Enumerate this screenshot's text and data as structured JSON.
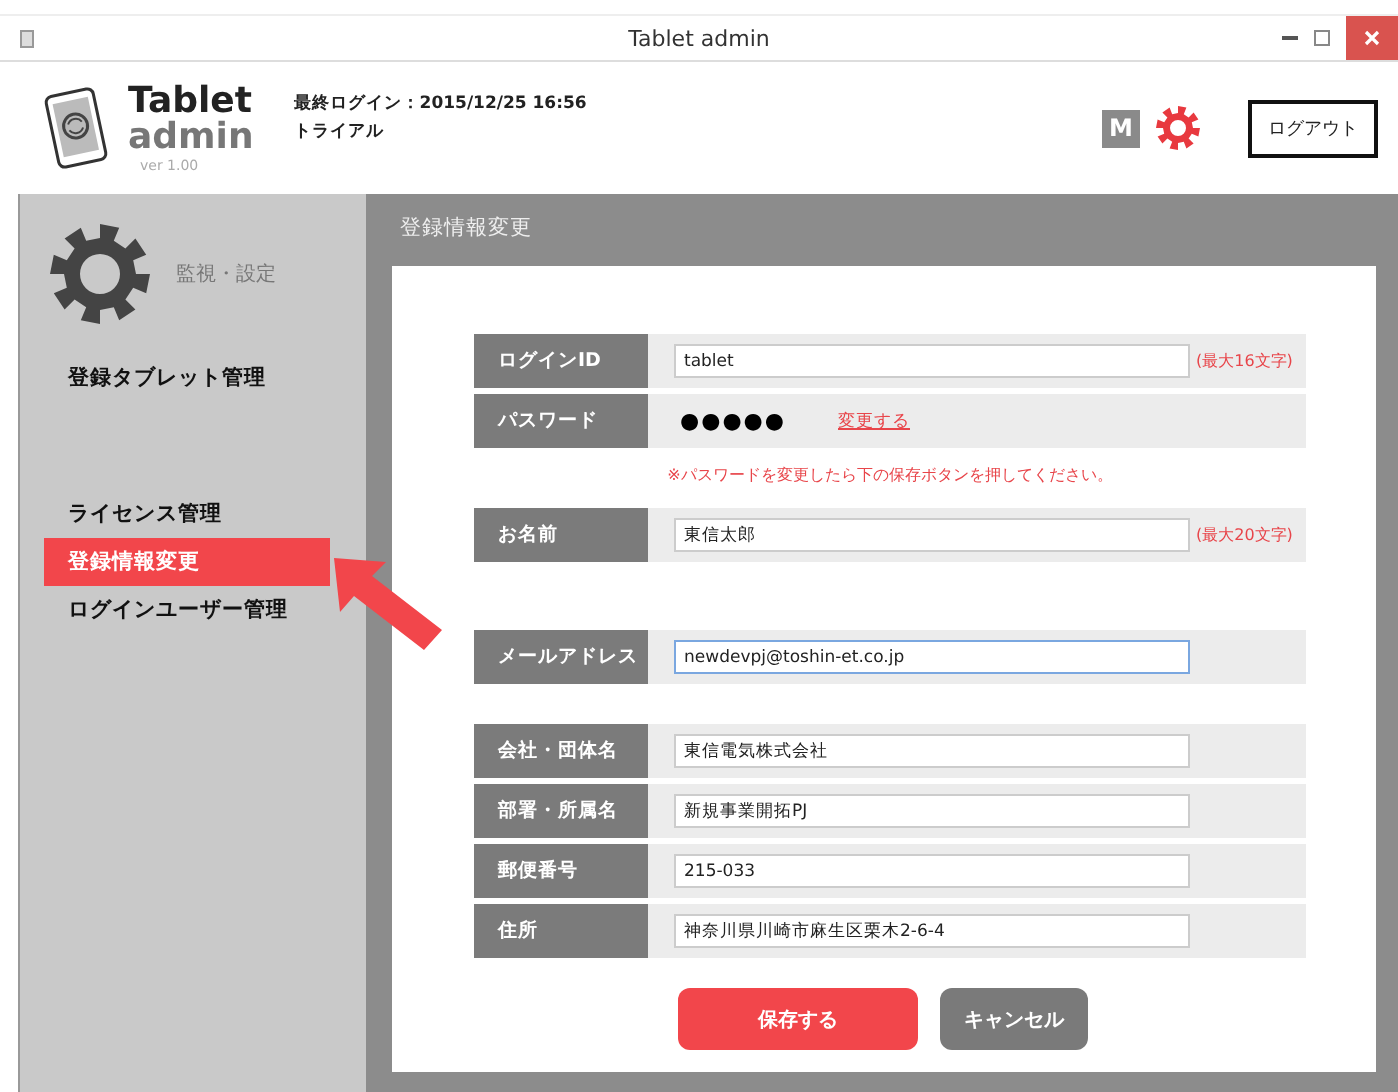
{
  "window": {
    "title": "Tablet admin"
  },
  "header": {
    "logo_title": "Tablet",
    "logo_subtitle": "admin",
    "version": "ver 1.00",
    "last_login": "最終ログイン：2015/12/25 16:56",
    "plan": "トライアル",
    "badge": "M",
    "logout": "ログアウト"
  },
  "sidebar": {
    "section": "監視・設定",
    "groups": [
      [
        {
          "label": "登録タブレット管理",
          "selected": false
        }
      ],
      [
        {
          "label": "ライセンス管理",
          "selected": false
        },
        {
          "label": "登録情報変更",
          "selected": true
        },
        {
          "label": "ログインユーザー管理",
          "selected": false
        }
      ]
    ]
  },
  "main": {
    "heading": "登録情報変更",
    "rows": [
      {
        "kind": "input",
        "label": "ログインID",
        "value": "tablet",
        "hint": "(最大16文字)",
        "focused": false
      },
      {
        "kind": "password",
        "label": "パスワード",
        "mask": "●●●●●",
        "link": "変更する"
      },
      {
        "kind": "note",
        "text": "※パスワードを変更したら下の保存ボタンを押してください。"
      },
      {
        "kind": "input",
        "label": "お名前",
        "value": "東信太郎",
        "hint": "(最大20文字)",
        "focused": false
      },
      {
        "kind": "spacer"
      },
      {
        "kind": "input",
        "label": "メールアドレス",
        "value": "newdevpj@toshin-et.co.jp",
        "focused": true
      },
      {
        "kind": "spacer"
      },
      {
        "kind": "input",
        "label": "会社・団体名",
        "value": "東信電気株式会社",
        "focused": false
      },
      {
        "kind": "input",
        "label": "部署・所属名",
        "value": "新規事業開拓PJ",
        "focused": false
      },
      {
        "kind": "input",
        "label": "郵便番号",
        "value": "215-033",
        "focused": false
      },
      {
        "kind": "input",
        "label": "住所",
        "value": "神奈川県川崎市麻生区栗木2-6-4",
        "focused": false
      }
    ],
    "buttons": [
      {
        "kind": "primary",
        "label": "保存する"
      },
      {
        "kind": "secondary",
        "label": "キャンセル"
      }
    ]
  }
}
